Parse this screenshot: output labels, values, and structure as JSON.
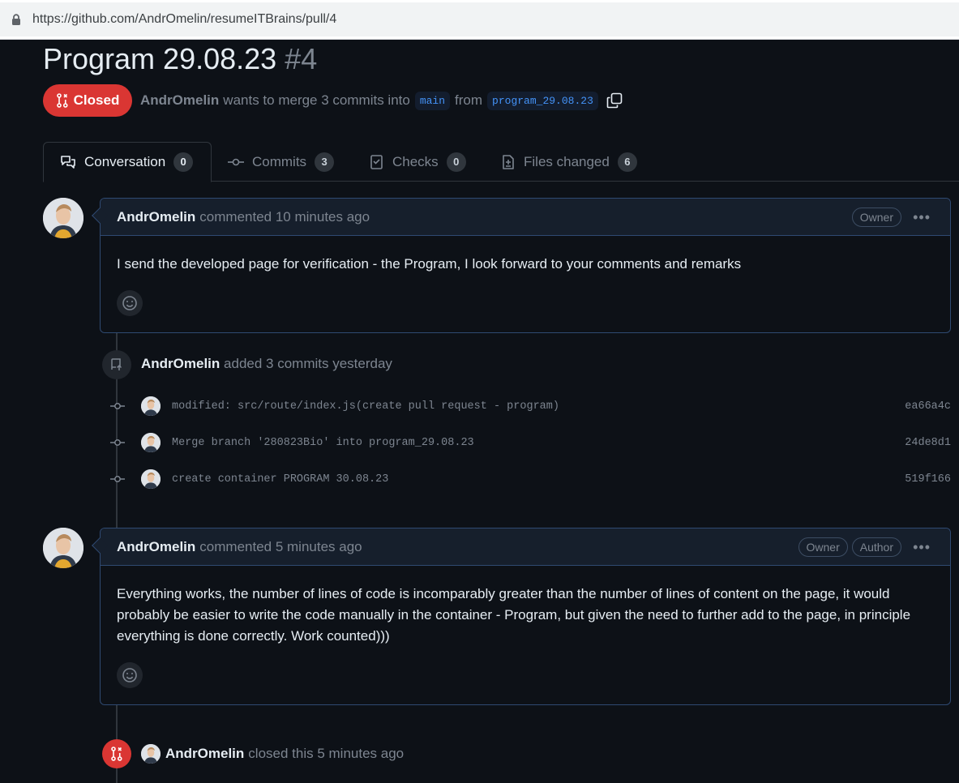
{
  "browser": {
    "url": "https://github.com/AndrOmelin/resumeITBrains/pull/4"
  },
  "pr": {
    "title": "Program 29.08.23",
    "number": "#4",
    "state": "Closed",
    "author": "AndrOmelin",
    "merge_text_1": "wants to merge 3 commits into",
    "base_branch": "main",
    "merge_text_2": "from",
    "head_branch": "program_29.08.23"
  },
  "tabs": [
    {
      "label": "Conversation",
      "count": "0"
    },
    {
      "label": "Commits",
      "count": "3"
    },
    {
      "label": "Checks",
      "count": "0"
    },
    {
      "label": "Files changed",
      "count": "6"
    }
  ],
  "comments": [
    {
      "author": "AndrOmelin",
      "meta": "commented 10 minutes ago",
      "badges": [
        "Owner"
      ],
      "body": "I send the developed page for verification - the Program, I look forward to your comments and remarks"
    },
    {
      "author": "AndrOmelin",
      "meta": "commented 5 minutes ago",
      "badges": [
        "Owner",
        "Author"
      ],
      "body": "Everything works, the number of lines of code is incomparably greater than the number of lines of content on the page, it would probably be easier to write the code manually in the container - Program, but given the need to further add to the page, in principle everything is done correctly. Work counted)))"
    }
  ],
  "commit_event": {
    "author": "AndrOmelin",
    "text": "added 3 commits yesterday",
    "commits": [
      {
        "message": "modified: src/route/index.js(create pull request - program)",
        "sha": "ea66a4c"
      },
      {
        "message": "Merge branch '280823Bio' into program_29.08.23",
        "sha": "24de8d1"
      },
      {
        "message": "create container PROGRAM 30.08.23",
        "sha": "519f166"
      }
    ]
  },
  "closed_event": {
    "author": "AndrOmelin",
    "text": "closed this 5 minutes ago"
  },
  "colors": {
    "accent": "#4493f8",
    "closed": "#da3633",
    "background": "#0d1117",
    "muted": "#7d8590"
  },
  "icons": [
    "lock-icon",
    "pr-closed-icon",
    "copy-icon",
    "conversation-icon",
    "commit-icon",
    "checks-icon",
    "diff-icon",
    "smiley-icon",
    "repo-push-icon",
    "kebab-icon"
  ]
}
